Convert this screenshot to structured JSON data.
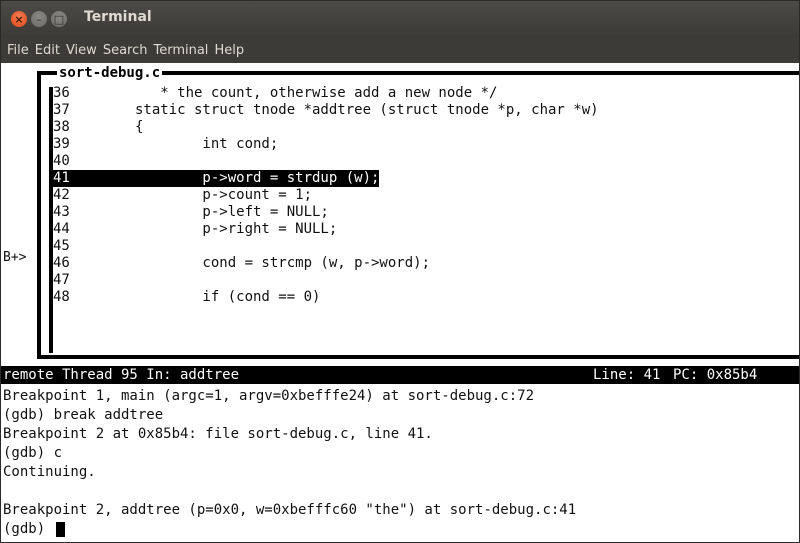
{
  "window": {
    "title": "Terminal",
    "close_glyph": "×",
    "min_glyph": "–",
    "max_glyph": "□"
  },
  "menubar": {
    "items": [
      "File",
      "Edit",
      "View",
      "Search",
      "Terminal",
      "Help"
    ]
  },
  "source_view": {
    "filename": "sort-debug.c",
    "breakpoint_marker": "B+>",
    "lines": [
      {
        "num": "36",
        "code": "   * the count, otherwise add a new node */"
      },
      {
        "num": "37",
        "code": "static struct tnode *addtree (struct tnode *p, char *w)"
      },
      {
        "num": "38",
        "code": "{"
      },
      {
        "num": "39",
        "code": "        int cond;"
      },
      {
        "num": "40",
        "code": ""
      },
      {
        "num": "41",
        "code": "        p->word = strdup (w);",
        "highlight": true
      },
      {
        "num": "42",
        "code": "        p->count = 1;"
      },
      {
        "num": "43",
        "code": "        p->left = NULL;"
      },
      {
        "num": "44",
        "code": "        p->right = NULL;"
      },
      {
        "num": "45",
        "code": ""
      },
      {
        "num": "46",
        "code": "        cond = strcmp (w, p->word);"
      },
      {
        "num": "47",
        "code": ""
      },
      {
        "num": "48",
        "code": "        if (cond == 0)"
      }
    ]
  },
  "status": {
    "left": "remote Thread 95 In: addtree",
    "line": "Line: 41",
    "pc": "PC: 0x85b4"
  },
  "console": {
    "lines": [
      "Breakpoint 1, main (argc=1, argv=0xbefffe24) at sort-debug.c:72",
      "(gdb) break addtree",
      "Breakpoint 2 at 0x85b4: file sort-debug.c, line 41.",
      "(gdb) c",
      "Continuing.",
      "",
      "Breakpoint 2, addtree (p=0x0, w=0xbefffc60 \"the\") at sort-debug.c:41"
    ],
    "prompt": "(gdb) "
  }
}
